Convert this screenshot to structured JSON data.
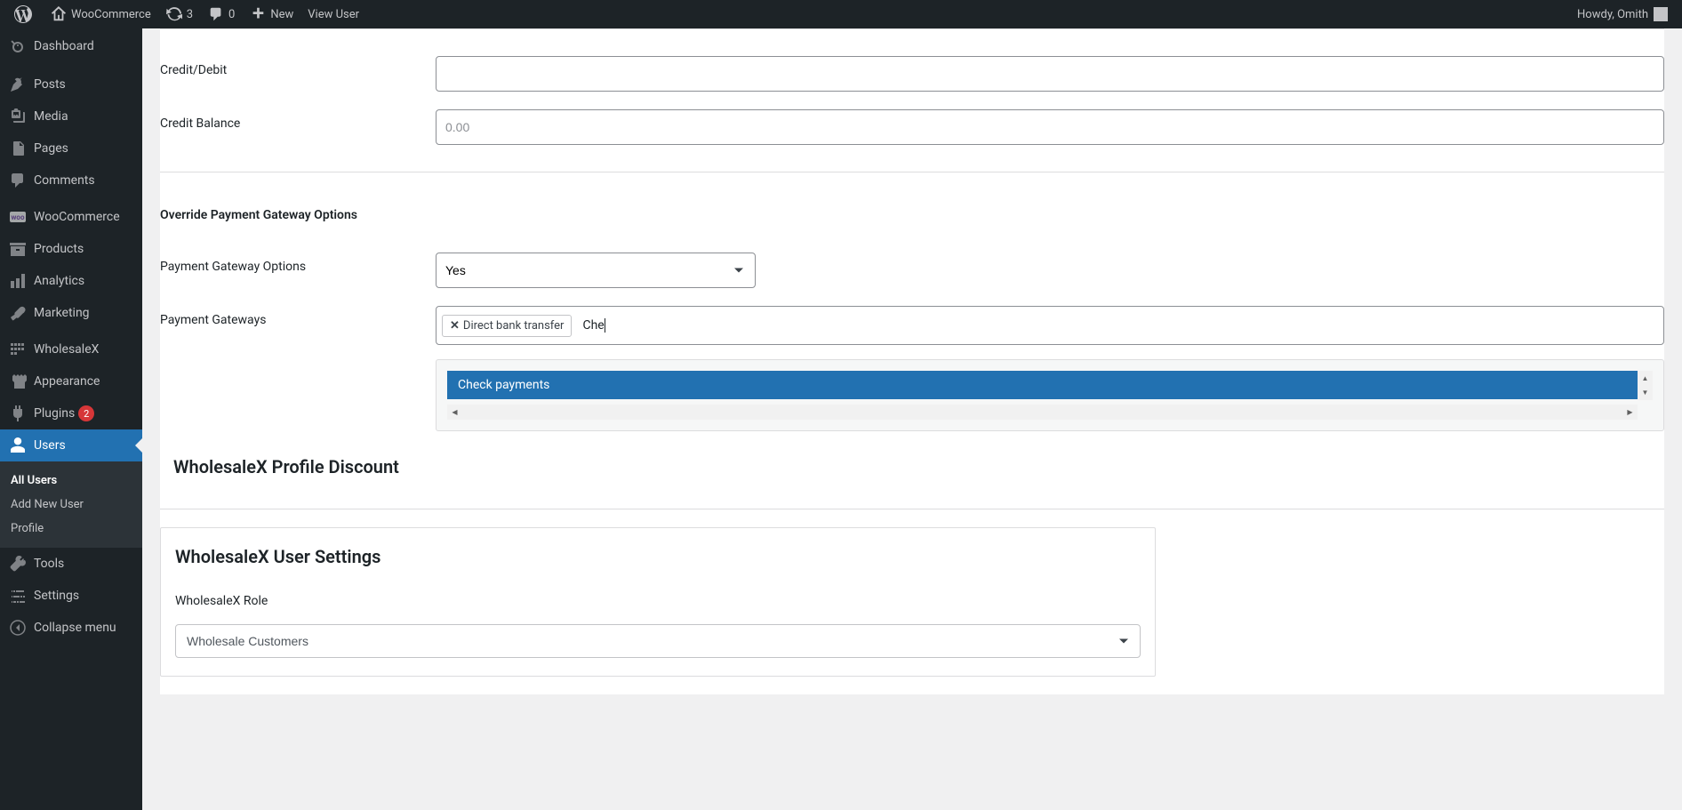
{
  "adminbar": {
    "site_name": "WooCommerce",
    "updates_count": "3",
    "comments_count": "0",
    "new_label": "New",
    "view_user_label": "View User",
    "howdy": "Howdy, Omith"
  },
  "sidebar": {
    "dashboard": "Dashboard",
    "posts": "Posts",
    "media": "Media",
    "pages": "Pages",
    "comments": "Comments",
    "woocommerce": "WooCommerce",
    "products": "Products",
    "analytics": "Analytics",
    "marketing": "Marketing",
    "wholesalex": "WholesaleX",
    "appearance": "Appearance",
    "plugins": "Plugins",
    "plugins_count": "2",
    "users": "Users",
    "all_users": "All Users",
    "add_new_user": "Add New User",
    "profile": "Profile",
    "tools": "Tools",
    "settings": "Settings",
    "collapse": "Collapse menu"
  },
  "form": {
    "credit_debit_label": "Credit/Debit",
    "credit_debit_value": "",
    "credit_balance_label": "Credit Balance",
    "credit_balance_placeholder": "0.00",
    "override_heading": "Override Payment Gateway Options",
    "payment_options_label": "Payment Gateway Options",
    "payment_options_value": "Yes",
    "payment_gateways_label": "Payment Gateways",
    "gateway_tag": "Direct bank transfer",
    "gateway_search": "Che",
    "dropdown_option": "Check payments",
    "profile_discount_title": "WholesaleX Profile Discount"
  },
  "settings_card": {
    "title": "WholesaleX User Settings",
    "role_label": "WholesaleX Role",
    "role_value": "Wholesale Customers"
  }
}
